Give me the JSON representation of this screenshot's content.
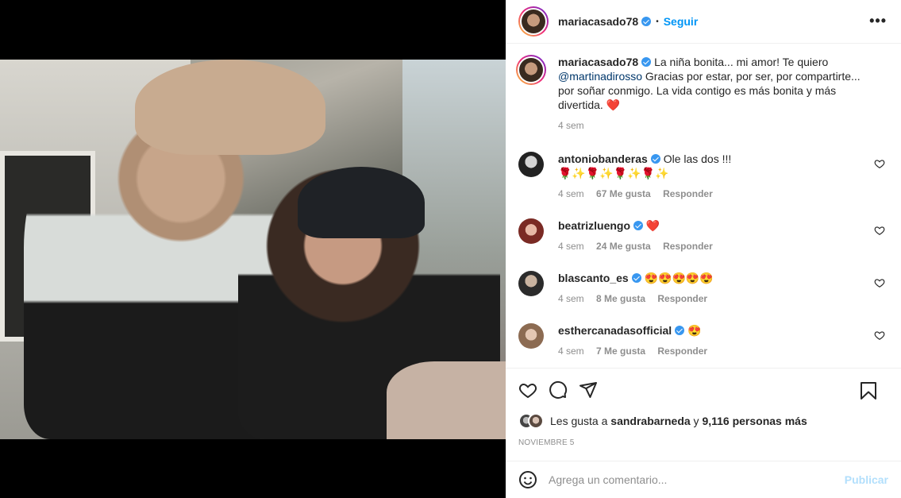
{
  "post": {
    "username": "mariacasado78",
    "follow_label": "Seguir",
    "dot": "•",
    "more_label": "•••",
    "caption": {
      "username": "mariacasado78",
      "text_1": "La niña bonita... mi amor! Te quiero",
      "mention": "@martinadirosso",
      "text_2": "Gracias por estar, por ser, por compartirte... por soñar conmigo. La vida contigo es más bonita y más divertida.",
      "emoji": "❤️",
      "time": "4 sem"
    }
  },
  "comments": [
    {
      "username": "antoniobanderas",
      "text": "Ole las dos !!!",
      "emoji_line": "🌹✨🌹✨🌹✨🌹✨",
      "time": "4 sem",
      "likes": "67 Me gusta",
      "reply": "Responder"
    },
    {
      "username": "beatrizluengo",
      "text": "❤️",
      "time": "4 sem",
      "likes": "24 Me gusta",
      "reply": "Responder"
    },
    {
      "username": "blascanto_es",
      "text": "😍😍😍😍😍",
      "time": "4 sem",
      "likes": "8 Me gusta",
      "reply": "Responder"
    },
    {
      "username": "esthercanadasofficial",
      "text": "😍",
      "time": "4 sem",
      "likes": "7 Me gusta",
      "reply": "Responder"
    }
  ],
  "actions": {
    "likes_prefix": "Les gusta a",
    "liker": "sandrabarneda",
    "likes_mid": "y",
    "likes_count": "9,116 personas más",
    "date": "NOVIEMBRE 5"
  },
  "composer": {
    "placeholder": "Agrega un comentario...",
    "publish_label": "Publicar"
  },
  "colors": {
    "link": "#0095f6",
    "mention": "#00376b",
    "muted": "#8e8e8e",
    "publish_disabled": "#b2dffc",
    "verified": "#3897f0"
  },
  "icons": [
    "heart-icon",
    "comment-icon",
    "share-icon",
    "bookmark-icon",
    "emoji-icon",
    "more-icon",
    "verified-icon"
  ]
}
